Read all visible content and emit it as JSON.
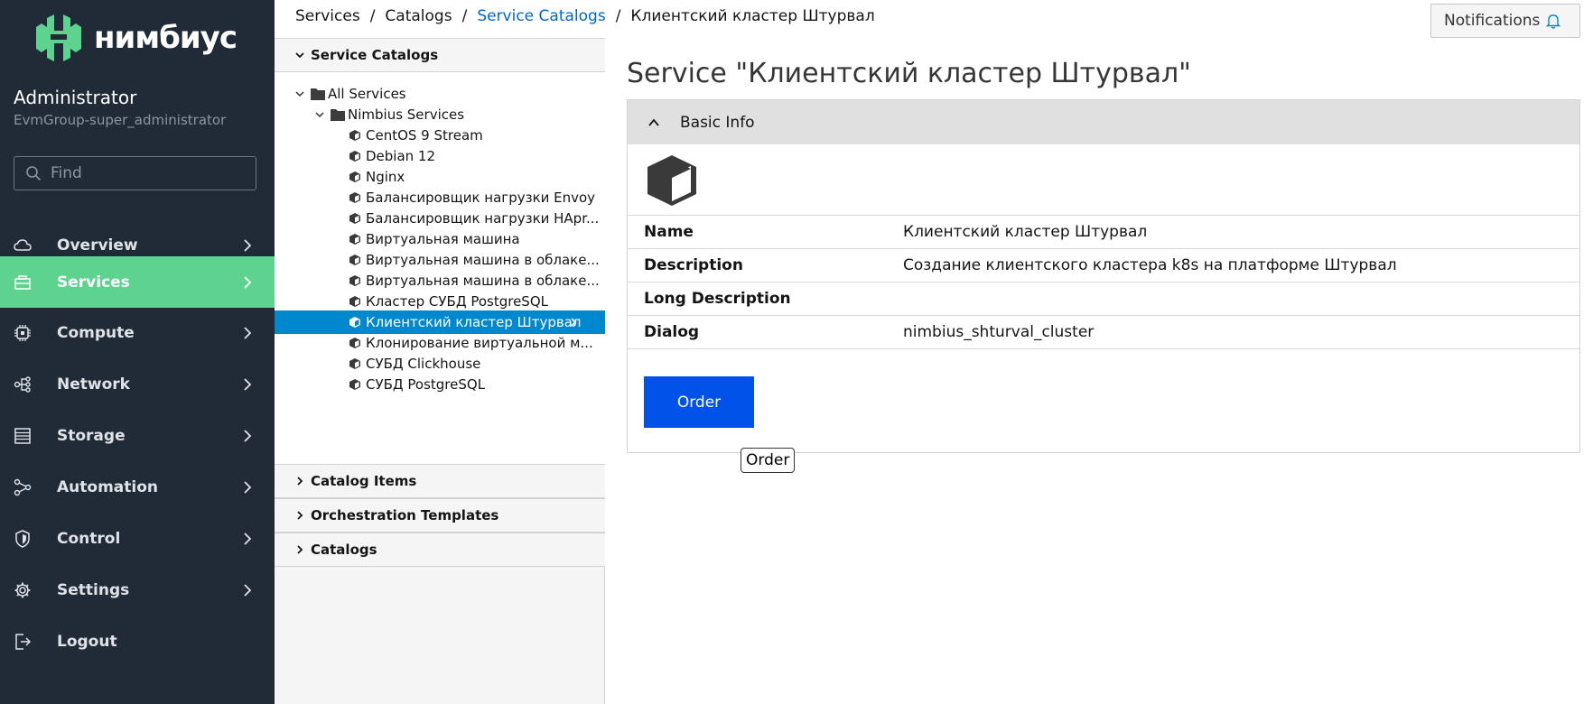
{
  "brand": {
    "name": "нимбиус",
    "color": "#5ed38f"
  },
  "user": {
    "name": "Administrator",
    "group": "EvmGroup-super_administrator"
  },
  "search": {
    "placeholder": "Find"
  },
  "nav": {
    "active_color": "#5ed38f",
    "items": [
      {
        "label": "Overview",
        "icon": "cloud-icon"
      },
      {
        "label": "Services",
        "icon": "services-icon",
        "active": true
      },
      {
        "label": "Compute",
        "icon": "cpu-icon"
      },
      {
        "label": "Network",
        "icon": "network-icon"
      },
      {
        "label": "Storage",
        "icon": "storage-icon"
      },
      {
        "label": "Automation",
        "icon": "automation-icon"
      },
      {
        "label": "Control",
        "icon": "shield-icon"
      },
      {
        "label": "Settings",
        "icon": "gear-icon"
      },
      {
        "label": "Logout",
        "icon": "logout-icon"
      }
    ]
  },
  "breadcrumb": {
    "items": [
      "Services",
      "Catalogs",
      "Service Catalogs",
      "Клиентский кластер Штурвал"
    ],
    "separator": "/"
  },
  "notifications": {
    "label": "Notifications",
    "icon": "bell-icon"
  },
  "tree_panel": {
    "sections": [
      "Service Catalogs",
      "Catalog Items",
      "Orchestration Templates",
      "Catalogs"
    ],
    "root": "All Services",
    "folder": "Nimbius Services",
    "items": [
      "CentOS 9 Stream",
      "Debian 12",
      "Nginx",
      "Балансировщик нагрузки Envoy",
      "Балансировщик нагрузки HApr...",
      "Виртуальная машина",
      "Виртуальная машина в облаке...",
      "Виртуальная машина в облаке...",
      "Кластер СУБД PostgreSQL",
      "Клиентский кластер Штурвал",
      "Клонирование виртуальной м...",
      "СУБД Clickhouse",
      "СУБД PostgreSQL"
    ],
    "selected": "Клиентский кластер Штурвал",
    "selected_color": "#0088ce"
  },
  "main": {
    "title": "Service \"Клиентский кластер Штурвал\"",
    "section_title": "Basic Info",
    "service_icon": "cube-icon",
    "fields": [
      {
        "key": "Name",
        "value": "Клиентский кластер Штурвал"
      },
      {
        "key": "Description",
        "value": "Создание клиентского кластера k8s на платформе Штурвал"
      },
      {
        "key": "Long Description",
        "value": ""
      },
      {
        "key": "Dialog",
        "value": "nimbius_shturval_cluster"
      }
    ],
    "order_label": "Order",
    "order_color": "#0052e8",
    "tooltip": "Order"
  }
}
